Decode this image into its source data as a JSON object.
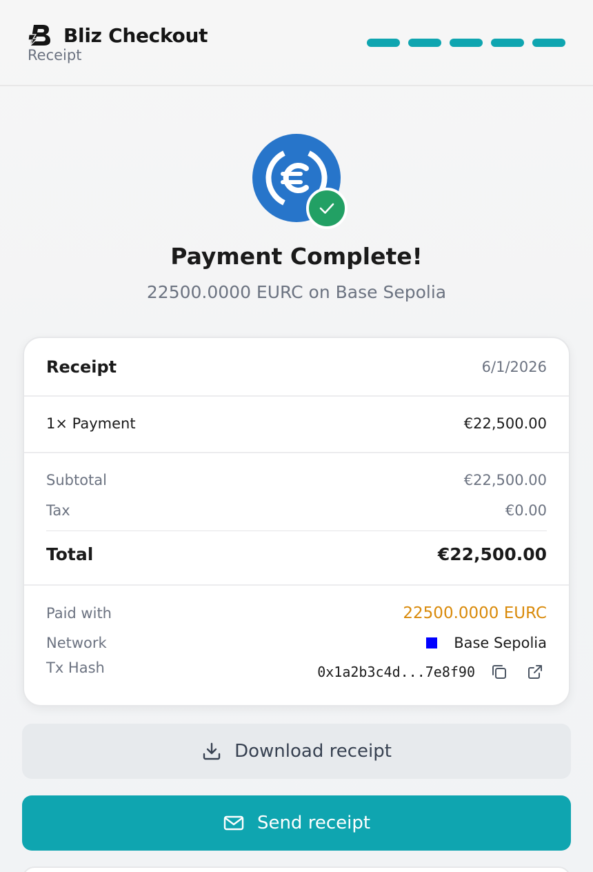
{
  "header": {
    "brand_name": "Bliz Checkout",
    "page_subtitle": "Receipt",
    "steps_total": 5,
    "steps_completed": 5,
    "accent_color": "#0fa5b0"
  },
  "hero": {
    "coin_icon": "eurc-coin-icon",
    "badge_icon": "check-icon",
    "title": "Payment Complete!",
    "subtitle": "22500.0000 EURC on Base Sepolia"
  },
  "receipt": {
    "heading": "Receipt",
    "date": "6/1/2026",
    "line_item": {
      "label": "1× Payment",
      "amount": "€22,500.00"
    },
    "subtotal": {
      "label": "Subtotal",
      "amount": "€22,500.00"
    },
    "tax": {
      "label": "Tax",
      "amount": "€0.00"
    },
    "total": {
      "label": "Total",
      "amount": "€22,500.00"
    },
    "paid_with": {
      "label": "Paid with",
      "value": "22500.0000 EURC"
    },
    "network": {
      "label": "Network",
      "value": "Base Sepolia",
      "color": "#0000ff"
    },
    "tx_hash": {
      "label": "Tx Hash",
      "value": "0x1a2b3c4d...7e8f90"
    }
  },
  "actions": {
    "download_label": "Download receipt",
    "send_label": "Send receipt"
  }
}
